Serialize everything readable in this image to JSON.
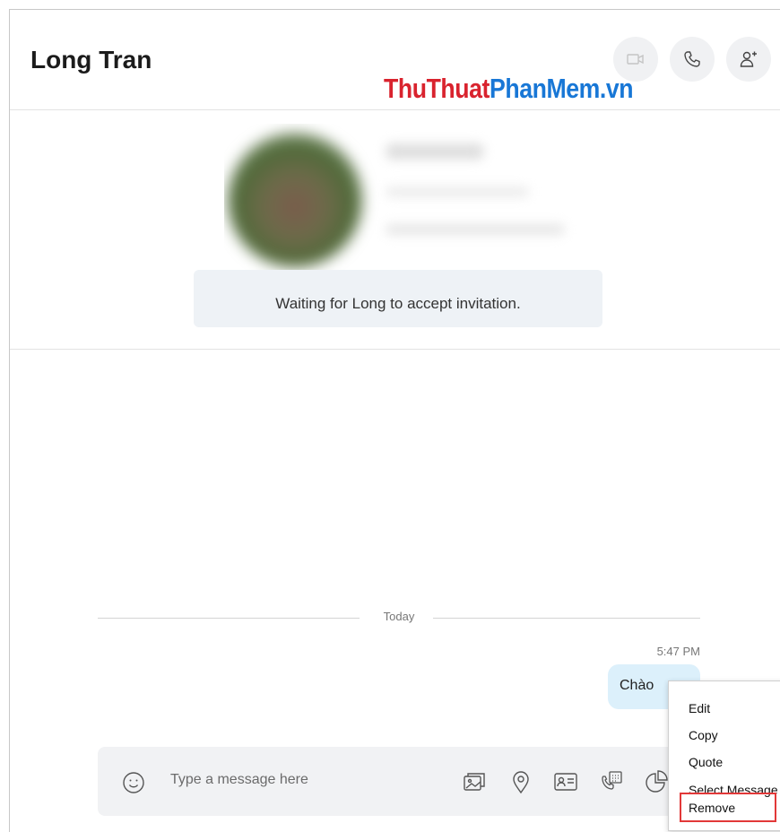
{
  "header": {
    "title": "Long Tran",
    "video_call_icon": "video-camera-icon",
    "audio_call_icon": "phone-icon",
    "add_people_icon": "add-person-icon"
  },
  "watermark": {
    "part1": "ThuThuat",
    "part2": "PhanMem.vn",
    "color1": "#d9232e",
    "color2": "#1877d6"
  },
  "contact": {
    "invitation_text": "Waiting for Long to accept invitation."
  },
  "conversation": {
    "day_label": "Today",
    "messages": [
      {
        "time": "5:47 PM",
        "text": "Chào"
      }
    ]
  },
  "composer": {
    "placeholder": "Type a message here",
    "tools": [
      "emoji-icon",
      "media-icon",
      "location-icon",
      "contact-card-icon",
      "schedule-call-icon",
      "poll-icon"
    ]
  },
  "context_menu": {
    "items": [
      {
        "label": "Edit"
      },
      {
        "label": "Copy"
      },
      {
        "label": "Quote"
      },
      {
        "label": "Select Message"
      },
      {
        "label": "Remove",
        "highlighted": true
      }
    ],
    "highlight_color": "#e23838"
  }
}
